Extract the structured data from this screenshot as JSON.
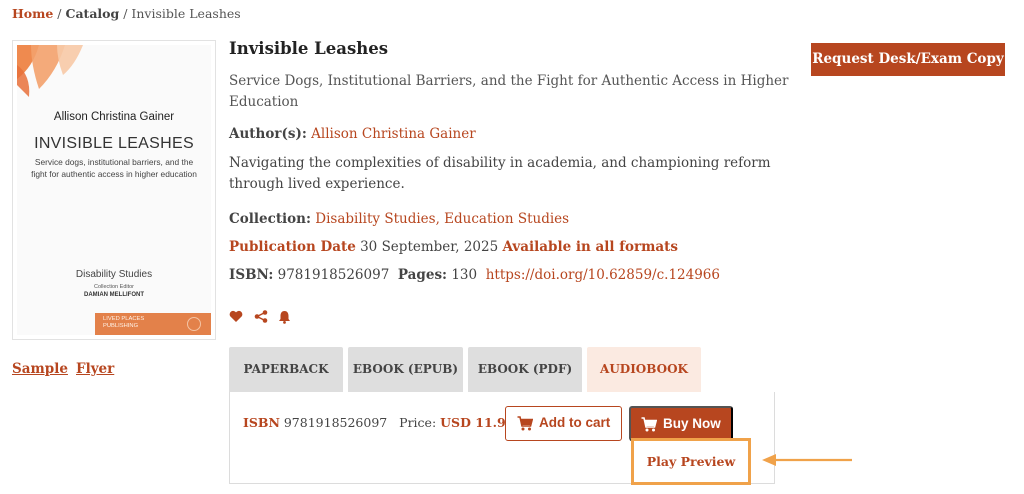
{
  "breadcrumb": {
    "home": "Home",
    "sep1": " / ",
    "catalog": "Catalog",
    "sep2": " / ",
    "current": "Invisible Leashes"
  },
  "cover": {
    "author": "Allison Christina Gainer",
    "title": "INVISIBLE LEASHES",
    "subtitle": "Service dogs, institutional barriers, and the fight for authentic access in higher education",
    "series": "Disability Studies",
    "editor_label": "Collection Editor",
    "editor": "DAMIAN MELLIFONT",
    "publisher_line1": "LIVED PLACES",
    "publisher_line2": "PUBLISHING"
  },
  "links": {
    "sample": "Sample",
    "flyer": "Flyer"
  },
  "book": {
    "title": "Invisible Leashes",
    "subtitle": "Service Dogs, Institutional Barriers, and the Fight for Authentic Access in Higher Education",
    "authors_label": "Author(s):",
    "author": "Allison Christina Gainer",
    "description": "Navigating the complexities of disability in academia, and championing reform through lived experience.",
    "collection_label": "Collection:",
    "collections": "Disability Studies, Education Studies",
    "pubdate_label": "Publication Date",
    "pubdate": "30 September, 2025",
    "availability": "Available in all formats",
    "isbn_label": "ISBN:",
    "isbn": "9781918526097",
    "pages_label": "Pages:",
    "pages": "130",
    "doi": "https://doi.org/10.62859/c.124966"
  },
  "request_button": "Request Desk/Exam Copy",
  "tabs": [
    {
      "label": "PAPERBACK"
    },
    {
      "label": "EBOOK (EPUB)"
    },
    {
      "label": "EBOOK (PDF)"
    },
    {
      "label": "AUDIOBOOK"
    }
  ],
  "active_tab": "AUDIOBOOK",
  "panel": {
    "isbn_label": "ISBN",
    "isbn": "9781918526097",
    "price_label": "Price:",
    "price": "USD 11.99",
    "add_to_cart": "Add to cart",
    "buy_now": "Buy Now",
    "play_preview": "Play Preview"
  },
  "icons": {
    "heart": "heart-icon",
    "share": "share-icon",
    "bell": "bell-icon",
    "cart": "cart-icon"
  },
  "colors": {
    "accent": "#b7461f",
    "highlight": "#f0a24a",
    "active_tab_bg": "#fbeae1",
    "tab_bg": "#dedede"
  }
}
